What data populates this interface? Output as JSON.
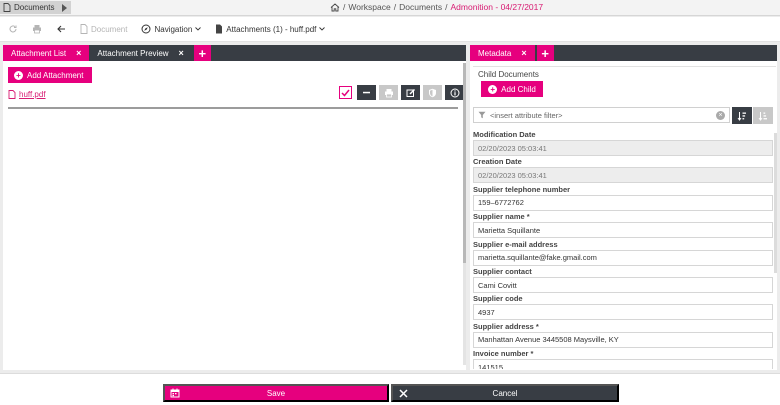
{
  "topbar": {
    "documents_label": "Documents",
    "breadcrumb": {
      "sep1": "/",
      "workspace": "Workspace",
      "sep2": "/",
      "documents": "Documents",
      "sep3": "/",
      "current": "Admonition - 04/27/2017"
    }
  },
  "toolbar": {
    "document_label": "Document",
    "navigation_label": "Navigation",
    "attachments_label": "Attachments (1) - huff.pdf"
  },
  "left_panel": {
    "tabs": [
      {
        "label": "Attachment List",
        "close": "×"
      },
      {
        "label": "Attachment Preview",
        "close": "×"
      }
    ],
    "add_tab": "+",
    "add_attachment_label": "Add Attachment",
    "file_name": "huff.pdf"
  },
  "right_panel": {
    "tab_label": "Metadata",
    "tab_close": "×",
    "add_tab": "+",
    "child_documents_title": "Child Documents",
    "add_child_label": "Add Child",
    "filter_placeholder": "<insert attribute filter>",
    "fields": [
      {
        "label": "Modification Date",
        "value": "02/20/2023 05:03:41",
        "readonly": true
      },
      {
        "label": "Creation Date",
        "value": "02/20/2023 05:03:41",
        "readonly": true
      },
      {
        "label": "Supplier telephone number",
        "value": "159–6772762",
        "readonly": false
      },
      {
        "label": "Supplier name *",
        "value": "Marietta Squillante",
        "readonly": false
      },
      {
        "label": "Supplier e-mail address",
        "value": "marietta.squillante@fake.gmail.com",
        "readonly": false
      },
      {
        "label": "Supplier contact",
        "value": "Cami Covitt",
        "readonly": false
      },
      {
        "label": "Supplier code",
        "value": "4937",
        "readonly": false
      },
      {
        "label": "Supplier address *",
        "value": "Manhattan Avenue 3445508 Maysville, KY",
        "readonly": false
      },
      {
        "label": "Invoice number *",
        "value": "141515",
        "readonly": false
      }
    ]
  },
  "footer": {
    "save_label": "Save",
    "cancel_label": "Cancel"
  },
  "colors": {
    "accent": "#e6007e",
    "dark": "#383d44"
  }
}
